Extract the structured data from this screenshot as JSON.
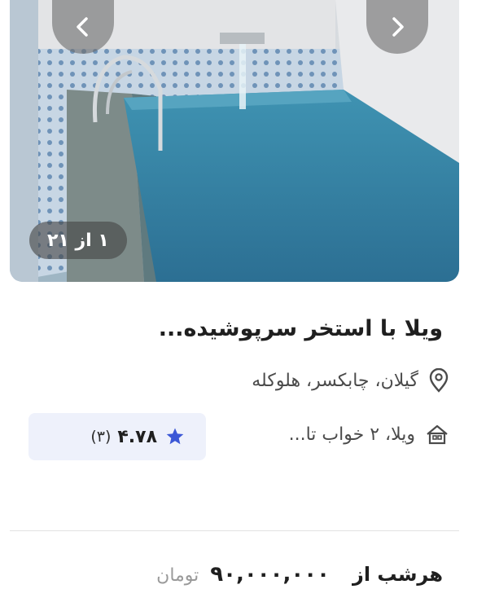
{
  "listing": {
    "gallery": {
      "counter": "۱ از ۲۱",
      "photo_subject": "indoor-pool-photo"
    },
    "title": "ویلا با استخر سرپوشیده...",
    "location": "گیلان، چابکسر، هلوکله",
    "specs": "ویلا، ۲ خواب تا...",
    "rating": {
      "count": "(۳)",
      "score": "۴.۷۸"
    },
    "price": {
      "per": "هرشب از",
      "amount": "۹۰,۰۰۰,۰۰۰",
      "currency": "تومان"
    }
  },
  "colors": {
    "star": "#3b57d6",
    "chip_bg": "#eef1fb",
    "text": "#1f1f1f",
    "muted": "#9a9a9a"
  },
  "icons": {
    "prev": "chevron-left-icon",
    "next": "chevron-right-icon",
    "location": "location-pin-icon",
    "property": "house-icon",
    "rating": "star-icon"
  }
}
